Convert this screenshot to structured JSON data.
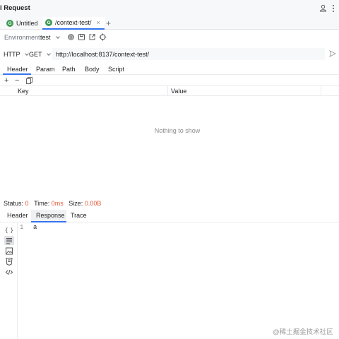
{
  "window": {
    "title": "l Request",
    "icons": [
      "user-icon",
      "more-vertical-icon"
    ]
  },
  "tabs": [
    {
      "label": "Untitled",
      "icon": "G",
      "active": false
    },
    {
      "label": "/context-test/",
      "icon": "G",
      "active": true,
      "close": "×"
    }
  ],
  "tab_add": "+",
  "environment": {
    "label": "Environment:",
    "value": "test",
    "icons": [
      "globe-script-icon",
      "save-icon",
      "external-link-icon",
      "settings-crosshair-icon"
    ]
  },
  "request": {
    "protocol": "HTTP",
    "method": "GET",
    "url": "http://localhost:8137/context-test/"
  },
  "request_tabs": [
    "Header",
    "Param",
    "Path",
    "Body",
    "Script"
  ],
  "request_tab_active": "Header",
  "toolbar": {
    "add": "+",
    "remove": "−"
  },
  "table": {
    "columns": [
      "Key",
      "Value"
    ],
    "empty_text": "Nothing to show"
  },
  "status": {
    "status_label": "Status:",
    "status_value": "0",
    "time_label": "Time:",
    "time_value": "0ms",
    "size_label": "Size:",
    "size_value": "0.00B",
    "colors": {
      "value": "#e55b3c"
    }
  },
  "response_tabs": [
    "Header",
    "Response",
    "Trace"
  ],
  "response_tab_active": "Response",
  "editor": {
    "lines": [
      {
        "number": "1",
        "text": "a"
      }
    ]
  },
  "watermark": "@稀土掘金技术社区",
  "colors": {
    "accent": "#3574f0",
    "tab_icon": "#3e9a55"
  }
}
